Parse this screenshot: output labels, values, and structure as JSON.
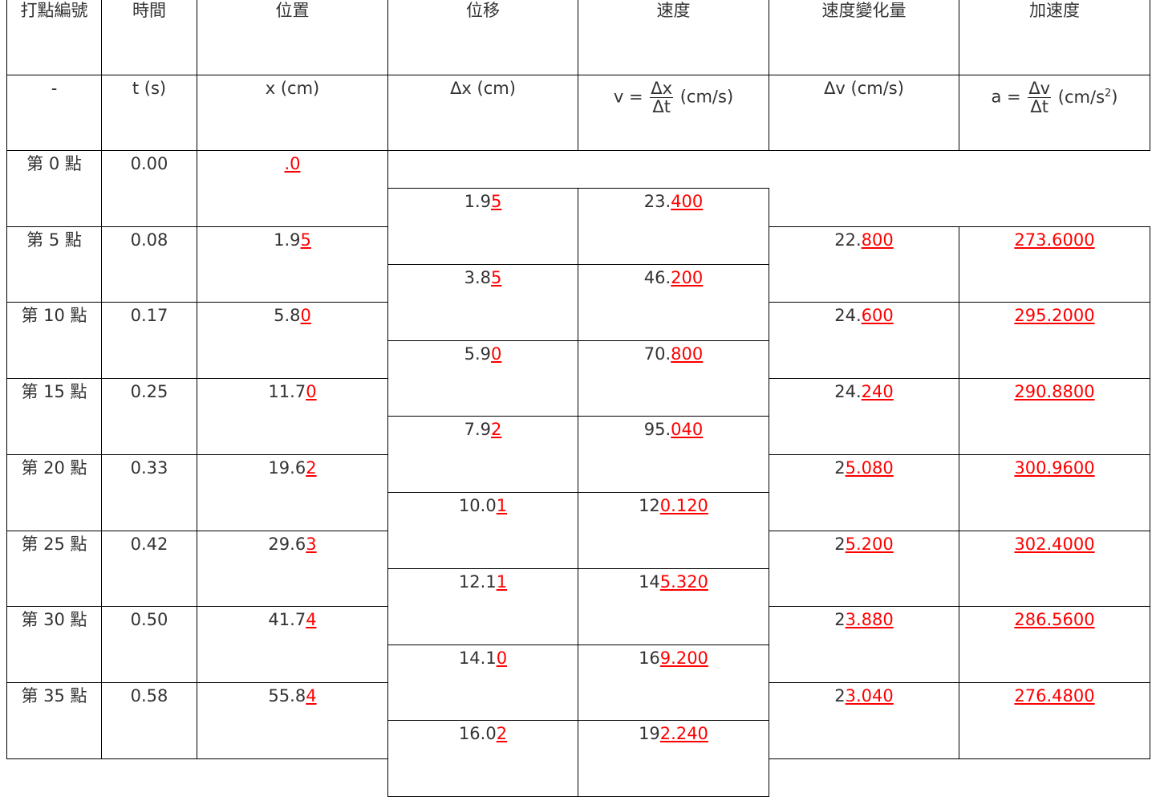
{
  "headers": [
    "打點編號",
    "時間",
    "位置",
    "位移",
    "速度",
    "速度變化量",
    "加速度"
  ],
  "units": {
    "id": "-",
    "t": "t (s)",
    "x": "x (cm)",
    "dx": "Δx (cm)",
    "v": {
      "lhs": "v =",
      "num": "Δx",
      "den": "Δt",
      "unit": "(cm/s)"
    },
    "dv": "Δv (cm/s)",
    "a": {
      "lhs": "a =",
      "num": "Δv",
      "den": "Δt",
      "unit_pre": "(cm/s",
      "unit_sup": "2",
      "unit_post": ")"
    }
  },
  "points": [
    {
      "label": "第 0 點",
      "t": "0.00",
      "x": [
        ".0"
      ]
    },
    {
      "label": "第 5 點",
      "t": "0.08",
      "x": [
        "1.9",
        "5"
      ]
    },
    {
      "label": "第 10 點",
      "t": "0.17",
      "x": [
        "5.8",
        "0"
      ]
    },
    {
      "label": "第 15 點",
      "t": "0.25",
      "x": [
        "11.7",
        "0"
      ]
    },
    {
      "label": "第 20 點",
      "t": "0.33",
      "x": [
        "19.6",
        "2"
      ]
    },
    {
      "label": "第 25 點",
      "t": "0.42",
      "x": [
        "29.6",
        "3"
      ]
    },
    {
      "label": "第 30 點",
      "t": "0.50",
      "x": [
        "41.7",
        "4"
      ]
    },
    {
      "label": "第 35 點",
      "t": "0.58",
      "x": [
        "55.8",
        "4"
      ]
    }
  ],
  "intervals": [
    {
      "dx": [
        "1.9",
        "5"
      ],
      "v": [
        "23.",
        "400"
      ]
    },
    {
      "dx": [
        "3.8",
        "5"
      ],
      "v": [
        "46.",
        "200"
      ]
    },
    {
      "dx": [
        "5.9",
        "0"
      ],
      "v": [
        "70.",
        "800"
      ]
    },
    {
      "dx": [
        "7.9",
        "2"
      ],
      "v": [
        "95.",
        "040"
      ]
    },
    {
      "dx": [
        "10.0",
        "1"
      ],
      "v": [
        "12",
        "0.120"
      ]
    },
    {
      "dx": [
        "12.1",
        "1"
      ],
      "v": [
        "14",
        "5.320"
      ]
    },
    {
      "dx": [
        "14.1",
        "0"
      ],
      "v": [
        "16",
        "9.200"
      ]
    },
    {
      "dx": [
        "16.0",
        "2"
      ],
      "v": [
        "19",
        "2.240"
      ]
    }
  ],
  "changes": [
    {
      "dv": [
        "22.",
        "800"
      ],
      "a": [
        "",
        "273.6000"
      ]
    },
    {
      "dv": [
        "24.",
        "600"
      ],
      "a": [
        "",
        "295.2000"
      ]
    },
    {
      "dv": [
        "24.",
        "240"
      ],
      "a": [
        "",
        "290.8800"
      ]
    },
    {
      "dv": [
        "2",
        "5.080"
      ],
      "a": [
        "",
        "300.9600"
      ]
    },
    {
      "dv": [
        "2",
        "5.200"
      ],
      "a": [
        "",
        "302.4000"
      ]
    },
    {
      "dv": [
        "2",
        "3.880"
      ],
      "a": [
        "",
        "286.5600"
      ]
    },
    {
      "dv": [
        "2",
        "3.040"
      ],
      "a": [
        "",
        "276.4800"
      ]
    }
  ],
  "colors": {
    "answer": "#ff0000",
    "text": "#333333",
    "border": "#000000"
  }
}
